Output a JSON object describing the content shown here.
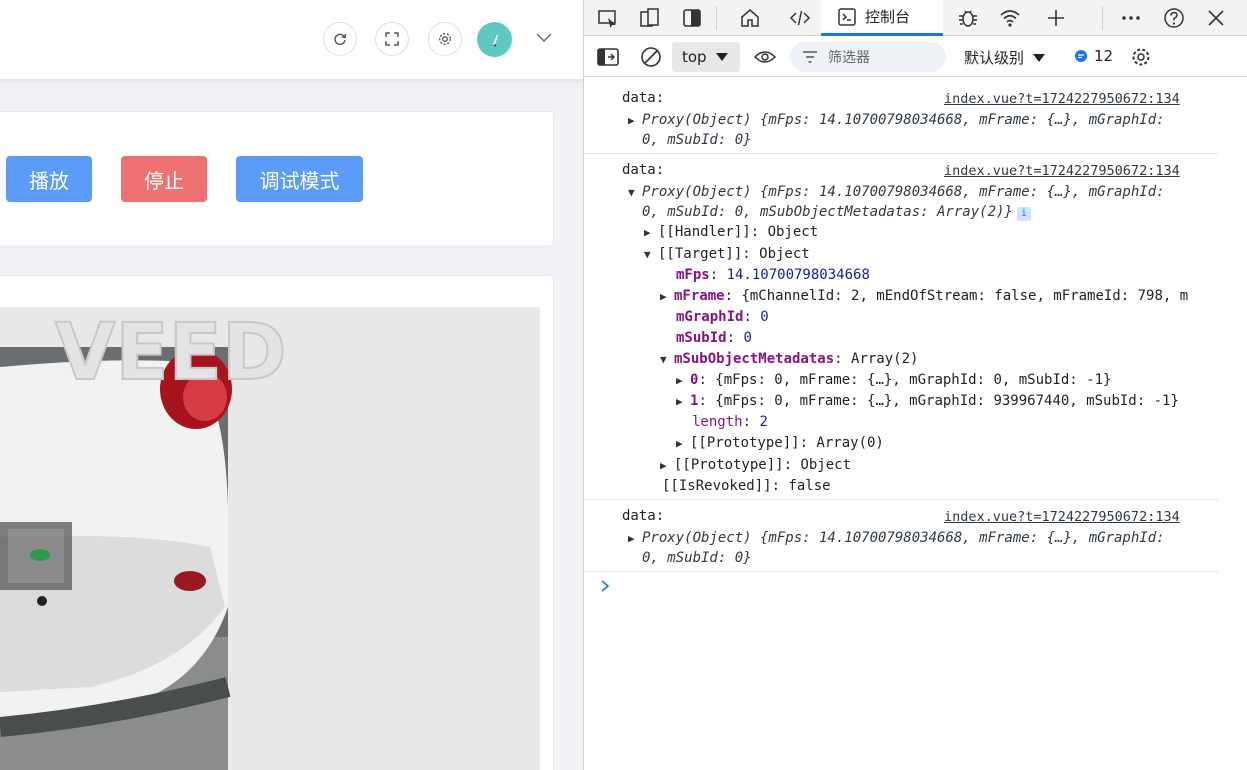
{
  "app": {
    "buttons": {
      "play": "播放",
      "stop": "停止",
      "debug": "调试模式"
    },
    "header_icons": [
      "refresh-icon",
      "fullscreen-icon",
      "settings-icon",
      "avatar",
      "chevron-down-icon"
    ],
    "video": {
      "overlay_text": "VEED"
    },
    "colors": {
      "primary": "#5b9cf8",
      "danger": "#ef7171",
      "avatar": "#5fc8c0"
    }
  },
  "devtools": {
    "tabs": {
      "console": "控制台"
    },
    "toolbar": {
      "context": "top",
      "filter_placeholder": "筛选器",
      "level": "默认级别",
      "message_count": "12"
    },
    "console": {
      "messages": [
        {
          "label": "data:",
          "source": "index.vue?t=1724227950672:134",
          "summary_line1": "Proxy(Object) {mFps: 14.10700798034668, mFrame: {…}, mGraphId:",
          "summary_line2": "0, mSubId: 0}"
        },
        {
          "label": "data:",
          "source": "index.vue?t=1724227950672:134",
          "summary_line1": "Proxy(Object) {mFps: 14.10700798034668, mFrame: {…}, mGraphId:",
          "summary_line2": "0, mSubId: 0, mSubObjectMetadatas: Array(2)}",
          "tree": {
            "handler": "[[Handler]]: Object",
            "target": "[[Target]]: Object",
            "mFps_key": "mFps",
            "mFps_val": "14.10700798034668",
            "mFrame": "{mChannelId: 2, mEndOfStream: false, mFrameId: 798, m",
            "mGraphId_val": "0",
            "mSubId_val": "0",
            "mSubObjectMetadatas_val": "Array(2)",
            "item0": "{mFps: 0, mFrame: {…}, mGraphId: 0, mSubId: -1}",
            "item1": "{mFps: 0, mFrame: {…}, mGraphId: 939967440, mSubId: -1}",
            "length_val": "2",
            "proto_array": "[[Prototype]]: Array(0)",
            "proto_object": "[[Prototype]]: Object",
            "revoked": "[[IsRevoked]]: false"
          }
        },
        {
          "label": "data:",
          "source": "index.vue?t=1724227950672:134",
          "summary_line1": "Proxy(Object) {mFps: 14.10700798034668, mFrame: {…}, mGraphId:",
          "summary_line2": "0, mSubId: 0}"
        }
      ]
    }
  }
}
